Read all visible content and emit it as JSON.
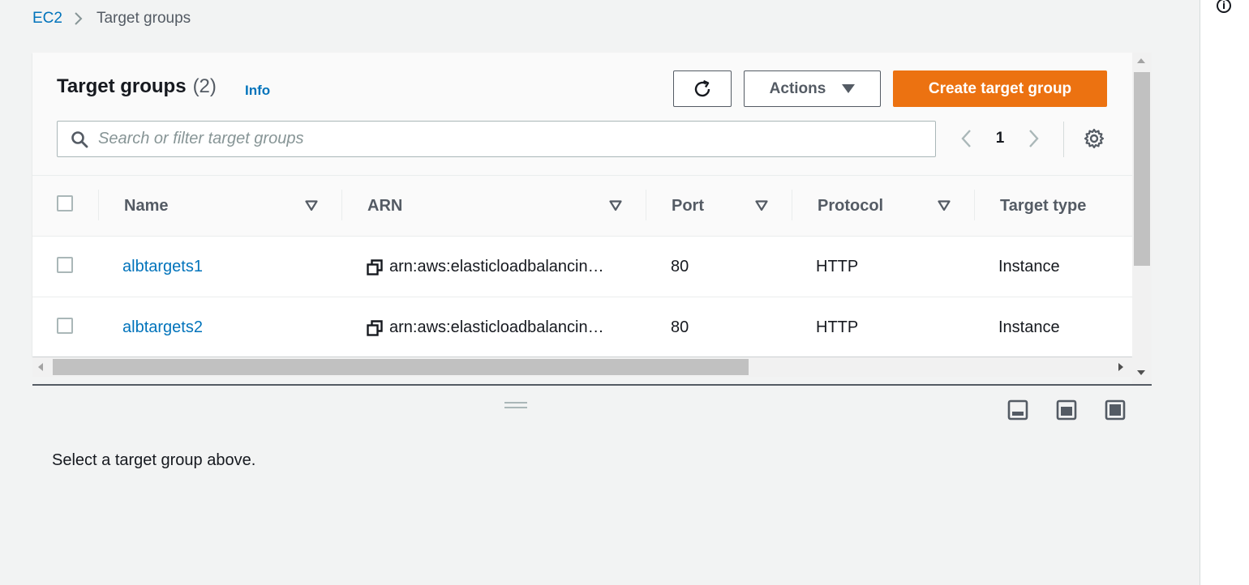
{
  "breadcrumb": {
    "root": "EC2",
    "current": "Target groups"
  },
  "header": {
    "title": "Target groups",
    "count": "(2)",
    "info": "Info",
    "refresh_icon": "refresh-icon",
    "actions_label": "Actions",
    "create_label": "Create target group"
  },
  "search": {
    "placeholder": "Search or filter target groups",
    "value": ""
  },
  "pagination": {
    "current_page": "1"
  },
  "table": {
    "columns": [
      "Name",
      "ARN",
      "Port",
      "Protocol",
      "Target type"
    ],
    "rows": [
      {
        "name": "albtargets1",
        "arn": "arn:aws:elasticloadbalancin…",
        "port": "80",
        "protocol": "HTTP",
        "target_type": "Instance"
      },
      {
        "name": "albtargets2",
        "arn": "arn:aws:elasticloadbalancin…",
        "port": "80",
        "protocol": "HTTP",
        "target_type": "Instance"
      }
    ]
  },
  "split_panel": {
    "empty_message": "Select a target group above."
  },
  "colors": {
    "primary": "#ec7211",
    "link": "#0073bb",
    "text": "#16191f",
    "muted": "#545b64",
    "background": "#f2f3f3"
  }
}
